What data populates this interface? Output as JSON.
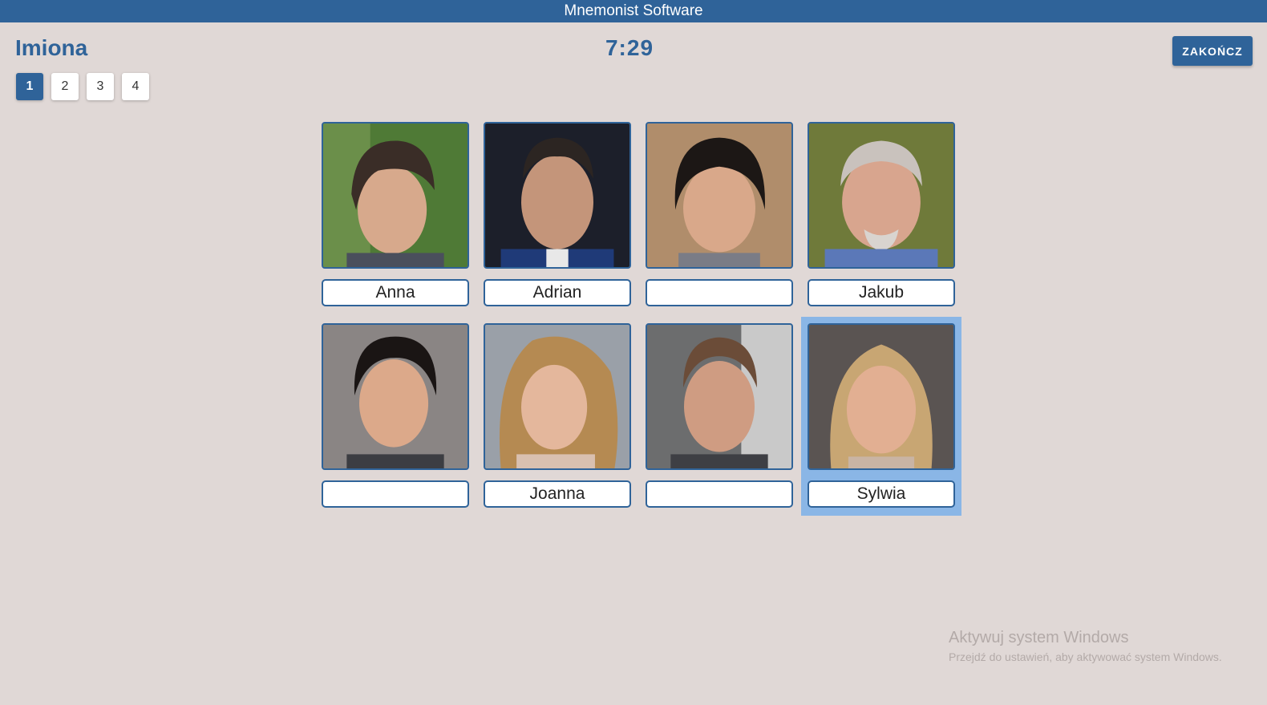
{
  "app": {
    "title": "Mnemonist Software"
  },
  "header": {
    "section_title": "Imiona",
    "timer": "7:29",
    "finish_label": "ZAKOŃCZ"
  },
  "pagination": {
    "pages": [
      "1",
      "2",
      "3",
      "4"
    ],
    "active": "1"
  },
  "cards": [
    {
      "name": "Anna"
    },
    {
      "name": "Adrian"
    },
    {
      "name": ""
    },
    {
      "name": "Jakub"
    },
    {
      "name": ""
    },
    {
      "name": "Joanna"
    },
    {
      "name": ""
    },
    {
      "name": "Sylwia"
    }
  ],
  "selected_card": 8,
  "watermark": {
    "title": "Aktywuj system Windows",
    "subtitle": "Przejdź do ustawień, aby aktywować system Windows."
  },
  "colors": {
    "accent": "#2f6399",
    "background": "#e0d8d6",
    "selection": "#8ab6e6"
  }
}
